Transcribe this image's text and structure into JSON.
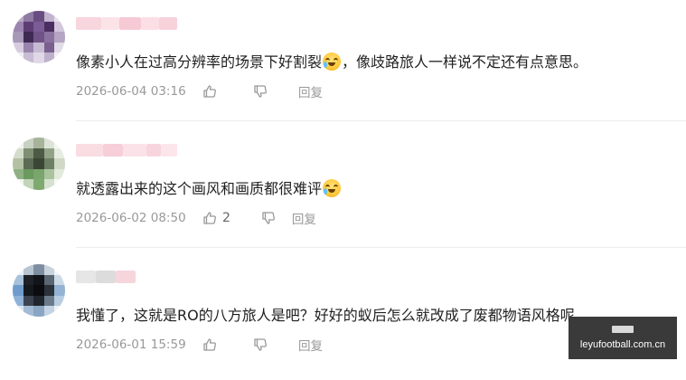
{
  "comments": [
    {
      "text_before": "像素小人在过高分辨率的场景下好割裂",
      "emoji": "laugh-cry-emoji",
      "text_after": "，像歧路旅人一样说不定还有点意思。",
      "time": "2026-06-04 03:16",
      "likes": "",
      "reply_label": "回复"
    },
    {
      "text_before": "就透露出来的这个画风和画质都很难评",
      "emoji": "laugh-cry-emoji",
      "text_after": "",
      "time": "2026-06-02 08:50",
      "likes": "2",
      "reply_label": "回复"
    },
    {
      "text_before": "我懂了，这就是RO的八方旅人是吧？好好的蚁后怎么就改成了废都物语风格呢",
      "emoji": "",
      "text_after": "",
      "time": "2026-06-01 15:59",
      "likes": "",
      "reply_label": "回复"
    }
  ],
  "watermark": {
    "text": "leyufootball.com.cn"
  },
  "colors": {
    "text": "#1f1f1f",
    "meta": "#999999",
    "divider": "#ececec"
  }
}
